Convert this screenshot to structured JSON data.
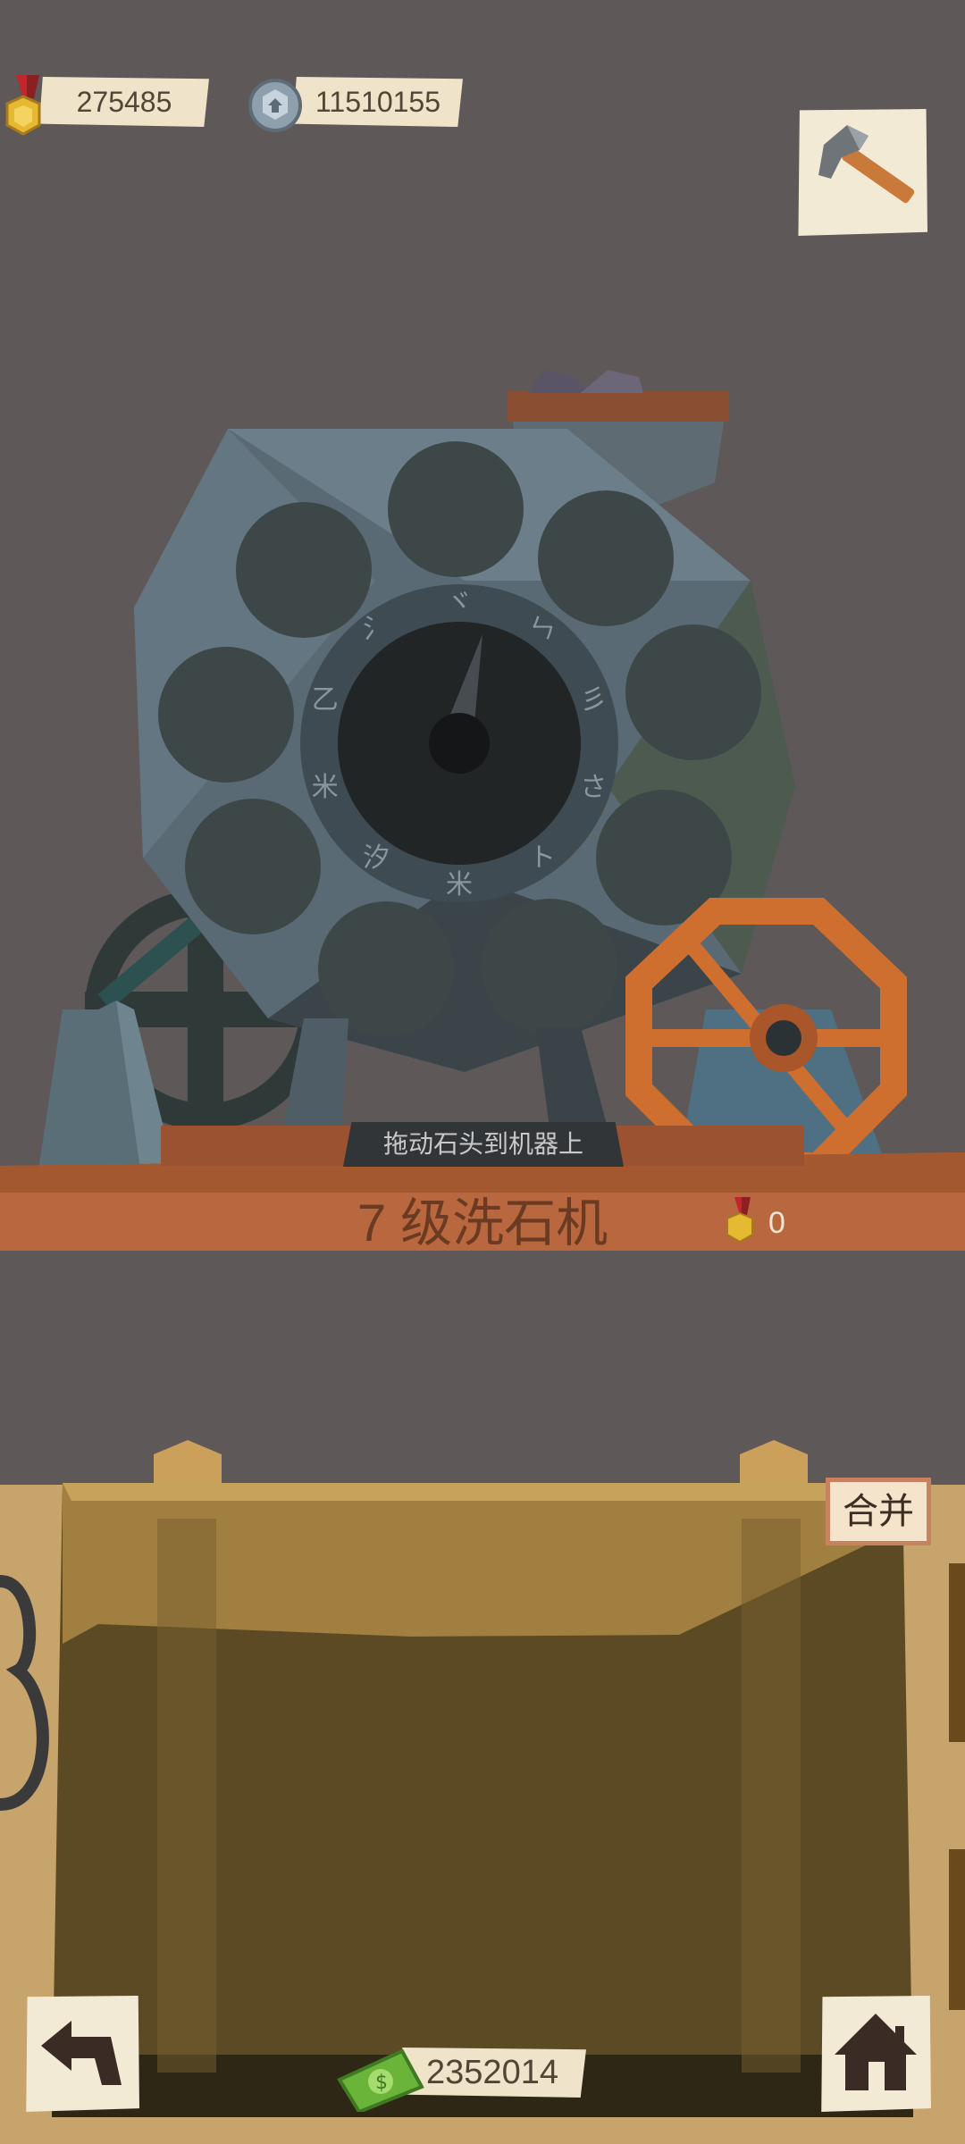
{
  "top_bar": {
    "medals": "275485",
    "nuts": "11510155"
  },
  "machine": {
    "hint": "拖动石头到机器上",
    "title": "7 级洗石机",
    "medal_count": "0",
    "dial_glyphs": [
      "ヾ",
      "ㄣ",
      "彡",
      "さ",
      "ト",
      "米",
      "汐",
      "米",
      "乙",
      "⺡"
    ]
  },
  "bin": {
    "merge_label": "合并"
  },
  "bottom_bar": {
    "money": "2352014"
  },
  "icons": {
    "medal": "medal-icon",
    "nut": "nut-icon",
    "pickaxe": "pickaxe-icon",
    "back": "back-arrow-icon",
    "home": "home-icon",
    "cash": "cash-icon"
  }
}
